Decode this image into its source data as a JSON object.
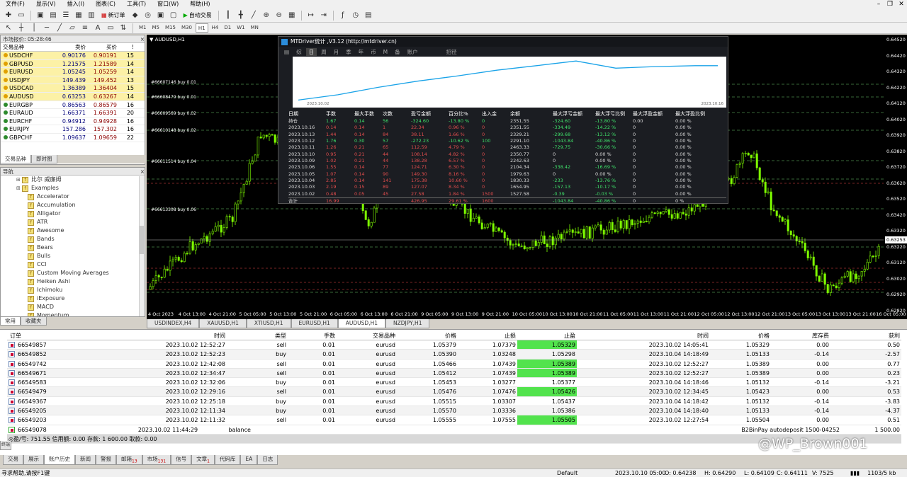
{
  "menu": [
    "文件(F)",
    "显示(V)",
    "插入(I)",
    "图表(C)",
    "工具(T)",
    "窗口(W)",
    "帮助(H)"
  ],
  "toolbar": {
    "new_order": "新订单",
    "auto_trade": "自动交易",
    "timeframes": [
      "M1",
      "M5",
      "M15",
      "M30",
      "H1",
      "H4",
      "D1",
      "W1",
      "MN"
    ],
    "active_tf": "H1"
  },
  "market": {
    "title": "市场报价: 05:28:46",
    "headers": [
      "交易品种",
      "卖价",
      "买价",
      "!"
    ],
    "rows": [
      {
        "sym": "USDCHF",
        "bid": "0.90176",
        "ask": "0.90191",
        "spr": "15",
        "hl": true
      },
      {
        "sym": "GBPUSD",
        "bid": "1.21575",
        "ask": "1.21589",
        "spr": "14",
        "hl": true
      },
      {
        "sym": "EURUSD",
        "bid": "1.05245",
        "ask": "1.05259",
        "spr": "14",
        "hl": true
      },
      {
        "sym": "USDJPY",
        "bid": "149.439",
        "ask": "149.452",
        "spr": "13",
        "hl": true
      },
      {
        "sym": "USDCAD",
        "bid": "1.36389",
        "ask": "1.36404",
        "spr": "15",
        "hl": true
      },
      {
        "sym": "AUDUSD",
        "bid": "0.63253",
        "ask": "0.63267",
        "spr": "14",
        "hl": true
      },
      {
        "sym": "EURGBP",
        "bid": "0.86563",
        "ask": "0.86579",
        "spr": "16",
        "hl": false
      },
      {
        "sym": "EURAUD",
        "bid": "1.66371",
        "ask": "1.66391",
        "spr": "20",
        "hl": false
      },
      {
        "sym": "EURCHF",
        "bid": "0.94912",
        "ask": "0.94928",
        "spr": "16",
        "hl": false
      },
      {
        "sym": "EURJPY",
        "bid": "157.286",
        "ask": "157.302",
        "spr": "16",
        "hl": false
      },
      {
        "sym": "GBPCHF",
        "bid": "1.09637",
        "ask": "1.09659",
        "spr": "22",
        "hl": false
      }
    ],
    "tabs": [
      "交易品种",
      "即时图"
    ]
  },
  "navigator": {
    "title": "导航",
    "items": [
      "比尔 威廉姆",
      "Examples",
      "Accelerator",
      "Accumulation",
      "Alligator",
      "ATR",
      "Awesome",
      "Bands",
      "Bears",
      "Bulls",
      "CCI",
      "Custom Moving Averages",
      "Heiken Ashi",
      "Ichimoku",
      "iExposure",
      "MACD",
      "Momentum"
    ],
    "tabs": [
      "常用",
      "收藏夹"
    ]
  },
  "chart": {
    "title": "AUDUSD,H1",
    "current_price": "0.63253",
    "price_ticks": [
      "0.64520",
      "0.64420",
      "0.64320",
      "0.64220",
      "0.64120",
      "0.64020",
      "0.63920",
      "0.63820",
      "0.63720",
      "0.63620",
      "0.63520",
      "0.63420",
      "0.63320",
      "0.63220",
      "0.63120",
      "0.63020",
      "0.62920",
      "0.62820"
    ],
    "time_ticks": [
      "4 Oct 2023",
      "4 Oct 13:00",
      "4 Oct 21:00",
      "5 Oct 05:00",
      "5 Oct 13:00",
      "5 Oct 21:00",
      "6 Oct 05:00",
      "6 Oct 13:00",
      "6 Oct 21:00",
      "9 Oct 05:00",
      "9 Oct 13:00",
      "9 Oct 21:00",
      "10 Oct 05:00",
      "10 Oct 13:00",
      "10 Oct 21:00",
      "11 Oct 05:00",
      "11 Oct 13:00",
      "11 Oct 21:00",
      "12 Oct 05:00",
      "12 Oct 13:00",
      "12 Oct 21:00",
      "13 Oct 05:00",
      "13 Oct 13:00",
      "13 Oct 21:00",
      "16 Oct 05:00"
    ],
    "trade_labels": [
      "#66607146 buy 0.01",
      "#66608479 buy 0.01",
      "#66609569 buy 0.02",
      "#66610148 buy 0.02",
      "#66611514 buy 0.04",
      "#66613308 buy 0.06"
    ],
    "tabs": [
      "USDINDEX,H4",
      "XAUUSD,H1",
      "XTIUSD,H1",
      "EURUSD,H1",
      "AUDUSD,H1",
      "NZDJPY,H1"
    ],
    "active_tab": "AUDUSD,H1"
  },
  "stats": {
    "title": "MTDriver统计 ,V3.12 (http://mtdriver.cn)",
    "tabs": [
      "综",
      "日",
      "周",
      "月",
      "季",
      "年",
      "币",
      "M",
      "备",
      "账户",
      "",
      "",
      "",
      "招径"
    ],
    "active_tab": "日",
    "eq_start": "2023.10.02",
    "eq_end": "2023.10.16",
    "headers": [
      "日期",
      "手数",
      "最大手数",
      "次数",
      "盈亏金额",
      "百分比%",
      "出入金",
      "余额",
      "最大浮亏金额",
      "最大浮亏比例",
      "最大浮盈金额",
      "最大浮盈比例"
    ],
    "rows": [
      {
        "c": [
          "持仓",
          "1.67",
          "0.14",
          "56",
          "-324.60",
          "-13.80 %",
          "0",
          "2351.55",
          "-324.60",
          "-13.80 %",
          "0.00",
          "0.00 %"
        ],
        "color": "grn"
      },
      {
        "c": [
          "2023.10.16",
          "0.14",
          "0.14",
          "1",
          "22.34",
          "0.96 %",
          "0",
          "2351.55",
          "-334.49",
          "-14.22 %",
          "0",
          "0.00 %"
        ],
        "color": "red"
      },
      {
        "c": [
          "2023.10.13",
          "1.44",
          "0.14",
          "84",
          "38.11",
          "1.66 %",
          "0",
          "2329.21",
          "-299.68",
          "-13.12 %",
          "0",
          "0.00 %"
        ],
        "color": "red"
      },
      {
        "c": [
          "2023.10.12",
          "1.76",
          "0.30",
          "57",
          "-272.23",
          "-10.62 %",
          "100",
          "2291.10",
          "-1043.84",
          "-40.86 %",
          "0",
          "0.00 %"
        ],
        "color": "grn"
      },
      {
        "c": [
          "2023.10.11",
          "1.26",
          "0.21",
          "65",
          "112.59",
          "4.79 %",
          "0",
          "2463.33",
          "-729.75",
          "-30.66 %",
          "0",
          "0.00 %"
        ],
        "color": "red"
      },
      {
        "c": [
          "2023.10.10",
          "0.95",
          "0.21",
          "44",
          "108.14",
          "4.82 %",
          "0",
          "2350.77",
          "0",
          "0.00 %",
          "0",
          "0.00 %"
        ],
        "color": "red"
      },
      {
        "c": [
          "2023.10.09",
          "1.02",
          "0.21",
          "44",
          "138.28",
          "6.57 %",
          "0",
          "2242.63",
          "0",
          "0.00 %",
          "0",
          "0.00 %"
        ],
        "color": "red"
      },
      {
        "c": [
          "2023.10.06",
          "1.55",
          "0.14",
          "77",
          "124.71",
          "6.30 %",
          "0",
          "2104.34",
          "-338.42",
          "-16.69 %",
          "0",
          "0.00 %"
        ],
        "color": "red"
      },
      {
        "c": [
          "2023.10.05",
          "1.07",
          "0.14",
          "90",
          "149.30",
          "8.16 %",
          "0",
          "1979.63",
          "0",
          "0.00 %",
          "0",
          "0.00 %"
        ],
        "color": "red"
      },
      {
        "c": [
          "2023.10.04",
          "2.85",
          "0.14",
          "141",
          "175.38",
          "10.60 %",
          "0",
          "1830.33",
          "-233",
          "-13.76 %",
          "0",
          "0.00 %"
        ],
        "color": "red"
      },
      {
        "c": [
          "2023.10.03",
          "2.19",
          "0.15",
          "89",
          "127.07",
          "8.34 %",
          "0",
          "1654.95",
          "-157.13",
          "-10.17 %",
          "0",
          "0.00 %"
        ],
        "color": "red"
      },
      {
        "c": [
          "2023.10.02",
          "0.48",
          "0.05",
          "45",
          "27.58",
          "1.84 %",
          "1500",
          "1527.58",
          "-0.39",
          "-0.03 %",
          "0",
          "0.00 %"
        ],
        "color": "red"
      }
    ],
    "total": [
      "合计",
      "16.99",
      "",
      "",
      "426.95",
      "29.61 %",
      "1600",
      "",
      "-1043.84",
      "-40.86 %",
      "0",
      "0 %"
    ]
  },
  "terminal": {
    "headers": [
      "订单",
      "时间",
      "类型",
      "手数",
      "交易品种",
      "价格",
      "止损",
      "止盈",
      "时间",
      "价格",
      "库存费",
      "获利"
    ],
    "rows": [
      {
        "c": [
          "66549857",
          "2023.10.02 12:52:27",
          "sell",
          "0.01",
          "eurusd",
          "1.05379",
          "1.07379",
          "1.05329",
          "2023.10.02 14:05:41",
          "1.05329",
          "0.00",
          "0.50"
        ],
        "tp_hl": true
      },
      {
        "c": [
          "66549852",
          "2023.10.02 12:52:23",
          "buy",
          "0.01",
          "eurusd",
          "1.05390",
          "1.03248",
          "1.05298",
          "2023.10.04 14:18:49",
          "1.05133",
          "-0.14",
          "-2.57"
        ],
        "tp_hl": false
      },
      {
        "c": [
          "66549742",
          "2023.10.02 12:42:08",
          "sell",
          "0.01",
          "eurusd",
          "1.05466",
          "1.07439",
          "1.05389",
          "2023.10.02 12:52:27",
          "1.05389",
          "0.00",
          "0.77"
        ],
        "tp_hl": true
      },
      {
        "c": [
          "66549671",
          "2023.10.02 12:34:47",
          "sell",
          "0.01",
          "eurusd",
          "1.05412",
          "1.07439",
          "1.05389",
          "2023.10.02 12:52:27",
          "1.05389",
          "0.00",
          "0.23"
        ],
        "tp_hl": true
      },
      {
        "c": [
          "66549583",
          "2023.10.02 12:32:06",
          "buy",
          "0.01",
          "eurusd",
          "1.05453",
          "1.03277",
          "1.05377",
          "2023.10.04 14:18:46",
          "1.05132",
          "-0.14",
          "-3.21"
        ],
        "tp_hl": false
      },
      {
        "c": [
          "66549479",
          "2023.10.02 12:29:16",
          "sell",
          "0.01",
          "eurusd",
          "1.05476",
          "1.07476",
          "1.05426",
          "2023.10.02 12:34:45",
          "1.05423",
          "0.00",
          "0.53"
        ],
        "tp_hl": true
      },
      {
        "c": [
          "66549367",
          "2023.10.02 12:25:18",
          "buy",
          "0.01",
          "eurusd",
          "1.05515",
          "1.03307",
          "1.05437",
          "2023.10.04 14:18:42",
          "1.05132",
          "-0.14",
          "-3.83"
        ],
        "tp_hl": false
      },
      {
        "c": [
          "66549205",
          "2023.10.02 12:11:34",
          "buy",
          "0.01",
          "eurusd",
          "1.05570",
          "1.03336",
          "1.05386",
          "2023.10.04 14:18:40",
          "1.05133",
          "-0.14",
          "-4.37"
        ],
        "tp_hl": false
      },
      {
        "c": [
          "66549203",
          "2023.10.02 12:11:32",
          "sell",
          "0.01",
          "eurusd",
          "1.05555",
          "1.07555",
          "1.05505",
          "2023.10.02 12:27:54",
          "1.05504",
          "0.00",
          "0.51"
        ],
        "tp_hl": true
      }
    ],
    "balance_row": {
      "order": "66549078",
      "time": "2023.10.02 11:44:29",
      "type": "balance",
      "comment": "B2BinPay autodeposit 1500-04252",
      "amount": "1 500.00"
    },
    "summary": "盈/亏: 751.55  信用额: 0.00  存款: 1 600.00  取款: 0.00",
    "tabs": [
      {
        "label": "交易",
        "sub": ""
      },
      {
        "label": "展示",
        "sub": ""
      },
      {
        "label": "账户历史",
        "sub": ""
      },
      {
        "label": "新闻",
        "sub": ""
      },
      {
        "label": "警报",
        "sub": ""
      },
      {
        "label": "邮箱",
        "sub": "13"
      },
      {
        "label": "市场",
        "sub": "131"
      },
      {
        "label": "信号",
        "sub": ""
      },
      {
        "label": "文章",
        "sub": "1"
      },
      {
        "label": "代码库",
        "sub": ""
      },
      {
        "label": "EA",
        "sub": ""
      },
      {
        "label": "日志",
        "sub": ""
      }
    ],
    "active_tab": "账户历史",
    "vtab": "终端"
  },
  "status": {
    "help": "寻求帮助,请按F1键",
    "profile": "Default",
    "time": "2023.10.10 05:00",
    "open": "O: 0.64238",
    "high": "H: 0.64290",
    "low": "L: 0.64109",
    "close": "C: 0.64111",
    "volume": "V: 7525",
    "traffic": "1103/5 kb"
  },
  "watermark": "@WP_Brown001"
}
